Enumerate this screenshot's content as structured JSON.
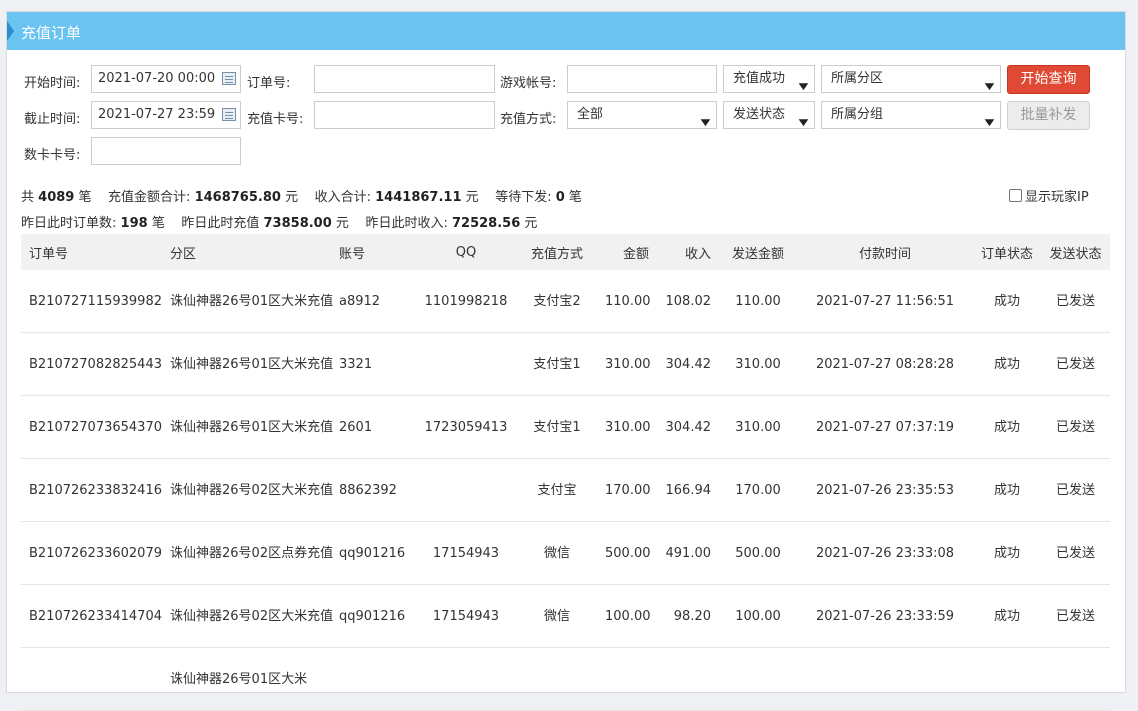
{
  "panel": {
    "title": "充值订单"
  },
  "filters": {
    "start_label": "开始时间:",
    "start_value": "2021-07-20 00:00",
    "end_label": "截止时间:",
    "end_value": "2021-07-27 23:59",
    "order_label": "订单号:",
    "card_label": "充值卡号:",
    "account_label": "游戏帐号:",
    "method_label": "充值方式:",
    "method_value": "全部",
    "status_value": "充值成功",
    "send_status_value": "发送状态",
    "region_value": "所属分区",
    "group_value": "所属分组",
    "serial_label": "数卡卡号:",
    "search_button": "开始查询",
    "resend_button": "批量补发"
  },
  "summary": {
    "total_prefix": "共",
    "total_count": "4089",
    "total_unit": "笔",
    "amount_label": "充值金额合计:",
    "amount_value": "1468765.80",
    "amount_unit": "元",
    "income_label": "收入合计:",
    "income_value": "1441867.11",
    "income_unit": "元",
    "pending_label": "等待下发:",
    "pending_value": "0",
    "pending_unit": "笔",
    "show_ip_label": "显示玩家IP",
    "y_orders_label": "昨日此时订单数:",
    "y_orders_value": "198",
    "y_orders_unit": "笔",
    "y_recharge_label": "昨日此时充值",
    "y_recharge_value": "73858.00",
    "y_recharge_unit": "元",
    "y_income_label": "昨日此时收入:",
    "y_income_value": "72528.56",
    "y_income_unit": "元"
  },
  "table": {
    "headers": [
      "订单号",
      "分区",
      "账号",
      "QQ",
      "充值方式",
      "金额",
      "收入",
      "发送金额",
      "付款时间",
      "订单状态",
      "发送状态"
    ],
    "rows": [
      [
        "B210727115939982",
        "诛仙神器26号01区大米充值",
        "a8912",
        "1101998218",
        "支付宝2",
        "110.00",
        "108.02",
        "110.00",
        "2021-07-27 11:56:51",
        "成功",
        "已发送"
      ],
      [
        "B210727082825443",
        "诛仙神器26号01区大米充值",
        "3321",
        "",
        "支付宝1",
        "310.00",
        "304.42",
        "310.00",
        "2021-07-27 08:28:28",
        "成功",
        "已发送"
      ],
      [
        "B210727073654370",
        "诛仙神器26号01区大米充值",
        "2601",
        "1723059413",
        "支付宝1",
        "310.00",
        "304.42",
        "310.00",
        "2021-07-27 07:37:19",
        "成功",
        "已发送"
      ],
      [
        "B210726233832416",
        "诛仙神器26号02区大米充值",
        "8862392",
        "",
        "支付宝",
        "170.00",
        "166.94",
        "170.00",
        "2021-07-26 23:35:53",
        "成功",
        "已发送"
      ],
      [
        "B210726233602079",
        "诛仙神器26号02区点券充值",
        "qq901216",
        "17154943",
        "微信",
        "500.00",
        "491.00",
        "500.00",
        "2021-07-26 23:33:08",
        "成功",
        "已发送"
      ],
      [
        "B210726233414704",
        "诛仙神器26号02区大米充值",
        "qq901216",
        "17154943",
        "微信",
        "100.00",
        "98.20",
        "100.00",
        "2021-07-26 23:33:59",
        "成功",
        "已发送"
      ],
      [
        "",
        "诛仙神器26号01区大米",
        "",
        "",
        "",
        "",
        "",
        "",
        "",
        "",
        ""
      ]
    ]
  }
}
